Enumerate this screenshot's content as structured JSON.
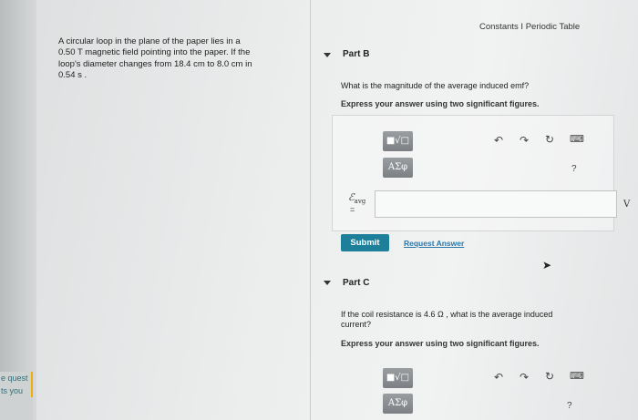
{
  "header": {
    "constants_label": "Constants",
    "separator": "I",
    "periodic_table_label": "Periodic Table"
  },
  "problem": {
    "lines": [
      "A circular loop in the plane of the paper lies in a",
      "0.50 T magnetic field pointing into the paper. If the",
      "loop's diameter changes from 18.4 cm to 8.0 cm in",
      "0.54 s ."
    ]
  },
  "part_b": {
    "title": "Part B",
    "question": "What is the magnitude of the average induced emf?",
    "instruction": "Express your answer using two significant figures.",
    "toolbar": {
      "template_btn": "■√□",
      "symbols_btn": "ΑΣφ",
      "help": "?"
    },
    "variable_label": "ℰ",
    "variable_sub": "avg",
    "equals": "=",
    "input_value": "",
    "unit": "V",
    "submit_label": "Submit",
    "request_label": "Request Answer"
  },
  "part_c": {
    "title": "Part C",
    "question_line1": "If the coil resistance is 4.6 Ω , what is the average induced",
    "question_line2": "current?",
    "instruction": "Express your answer using two significant figures.",
    "toolbar": {
      "template_btn": "■√□",
      "symbols_btn": "ΑΣφ",
      "help": "?"
    }
  },
  "edge_text": {
    "line1": "e quest",
    "line2": "ts you"
  },
  "icons": [
    "undo-icon",
    "redo-icon",
    "reset-icon",
    "keyboard-icon",
    "caret-down-icon",
    "cursor-icon"
  ]
}
